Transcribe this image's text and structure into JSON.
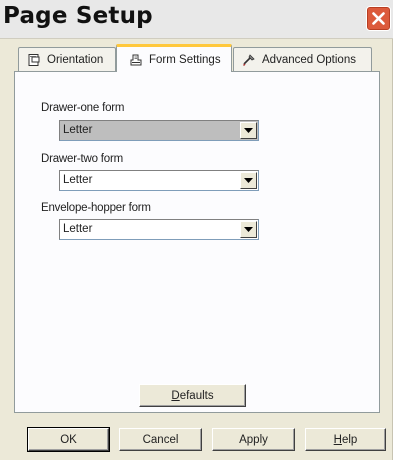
{
  "window": {
    "title": "Page Setup"
  },
  "tabs": [
    {
      "label": "Orientation",
      "icon": "orientation-icon",
      "active": false
    },
    {
      "label": "Form Settings",
      "icon": "form-settings-icon",
      "active": true
    },
    {
      "label": "Advanced Options",
      "icon": "advanced-options-icon",
      "active": false
    }
  ],
  "form": {
    "drawer_one": {
      "label": "Drawer-one form",
      "value": "Letter"
    },
    "drawer_two": {
      "label": "Drawer-two form",
      "value": "Letter"
    },
    "envelope_hopper": {
      "label": "Envelope-hopper form",
      "value": "Letter"
    }
  },
  "buttons": {
    "defaults": "Defaults",
    "ok": "OK",
    "cancel": "Cancel",
    "apply": "Apply",
    "help": "Help"
  },
  "colors": {
    "dialog_bg": "#ece9d8",
    "panel_bg": "#fcfcfe",
    "active_tab_accent": "#ffc83c",
    "close_button": "#dc5a3b"
  }
}
